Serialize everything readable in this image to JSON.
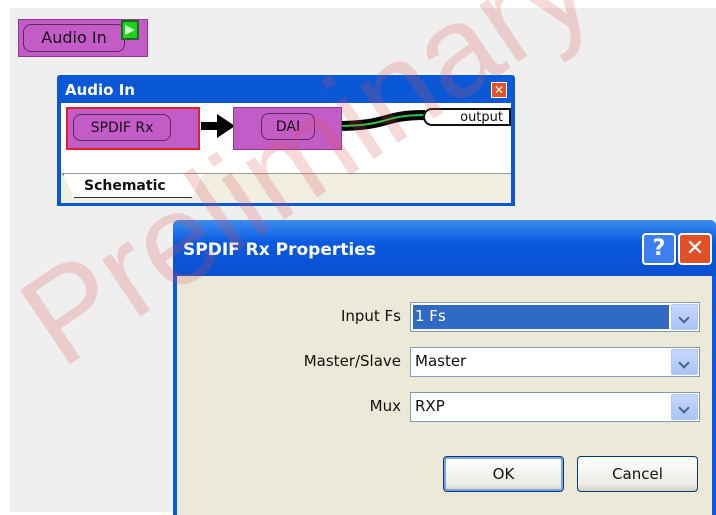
{
  "audio_in_block": {
    "label": "Audio In"
  },
  "schematic_window": {
    "title": "Audio In",
    "close_glyph": "✕",
    "nodes": {
      "spdif_label": "SPDIF Rx",
      "dai_label": "DAI",
      "output_label": "output"
    },
    "tab_label": "Schematic"
  },
  "dialog": {
    "title": "SPDIF Rx Properties",
    "help_glyph": "?",
    "close_glyph": "✕",
    "fields": [
      {
        "label": "Input Fs",
        "value": "1 Fs",
        "selected": true
      },
      {
        "label": "Master/Slave",
        "value": "Master",
        "selected": false
      },
      {
        "label": "Mux",
        "value": "RXP",
        "selected": false
      }
    ],
    "ok_label": "OK",
    "cancel_label": "Cancel"
  },
  "watermark": "Preliminary",
  "colors": {
    "block": "#c45cc8",
    "titlebar": "#0a5ae0",
    "selection": "#316ac5"
  }
}
